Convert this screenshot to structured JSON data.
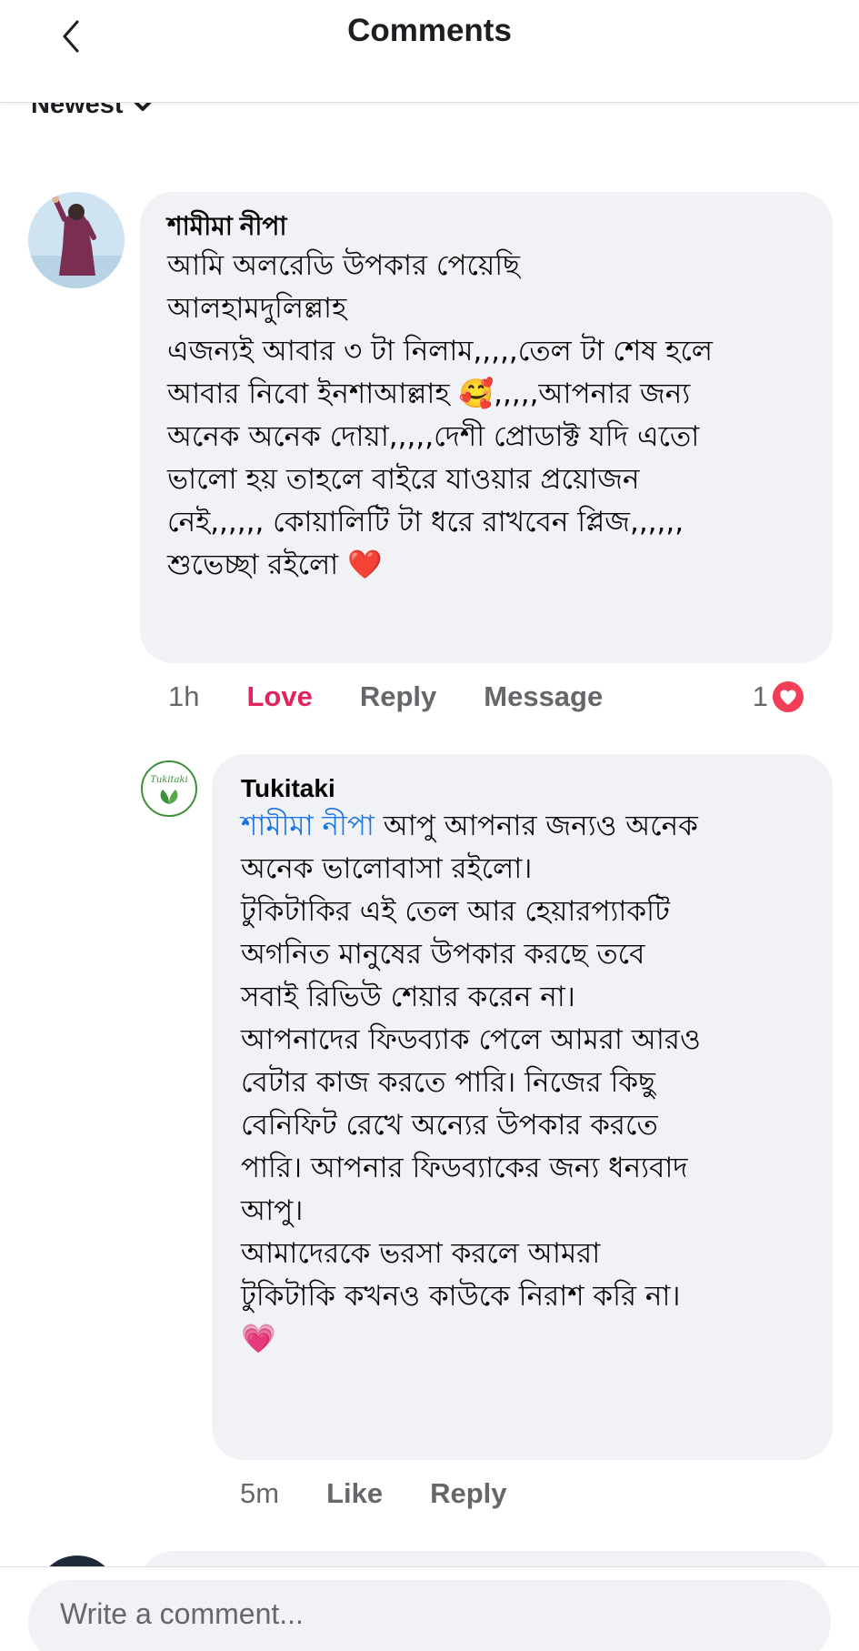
{
  "header": {
    "title": "Comments",
    "back_icon": "chevron-left-icon"
  },
  "sort": {
    "label": "Newest",
    "icon": "chevron-down-icon"
  },
  "comments": [
    {
      "author": "শামীমা নীপা",
      "lines": [
        "আমি অলরেডি উপকার পেয়েছি",
        "আলহামদুলিল্লাহ",
        "এজন্যই আবার ৩ টা নিলাম,,,,,তেল টা শেষ হলে",
        "আবার নিবো ইনশাআল্লাহ",
        ",,,,,আপনার জন্য",
        "অনেক অনেক দোয়া,,,,,দেশী প্রোডাক্ট যদি এতো",
        "ভালো হয় তাহলে বাইরে যাওয়ার প্রয়োজন",
        "নেই,,,,,, কোয়ালিটি টা ধরে রাখবেন প্লিজ,,,,,,",
        "শুভেচ্ছা রইলো"
      ],
      "emoji_smiling_hearts": "🥰",
      "emoji_red_heart": "❤️",
      "time": "1h",
      "actions": [
        "Love",
        "Reply",
        "Message"
      ],
      "reaction_count": "1",
      "reaction_icon": "love-reaction-icon"
    },
    {
      "author": "Tukitaki",
      "avatar_text": "Tukitaki",
      "mention": "শামীমা নীপা",
      "first_line_rest": " আপু আপনার জন্যও অনেক",
      "lines": [
        "অনেক ভালোবাসা রইলো।",
        "টুকিটাকির এই তেল আর হেয়ারপ্যাকটি",
        "অগনিত মানুষের উপকার করছে তবে",
        "সবাই রিভিউ শেয়ার করেন না।",
        "আপনাদের ফিডব্যাক পেলে আমরা আরও",
        "বেটার কাজ করতে পারি। নিজের কিছু",
        "বেনিফিট রেখে অন্যের উপকার করতে",
        "পারি। আপনার ফিডব্যাকের জন্য ধন্যবাদ",
        "আপু।",
        "আমাদেরকে ভরসা করলে আমরা",
        "টুকিটাকি কখনও কাউকে নিরাশ করি না।"
      ],
      "emoji_heart": "💗",
      "time": "5m",
      "actions": [
        "Like",
        "Reply"
      ]
    }
  ],
  "composer": {
    "placeholder": "Write a comment..."
  },
  "colors": {
    "love": "#e0245e",
    "mention": "#1b74e4",
    "bubble": "#f0f2f5",
    "muted": "#65676b"
  }
}
